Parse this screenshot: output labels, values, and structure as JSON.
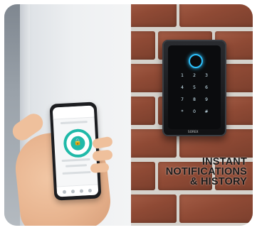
{
  "caption": {
    "line1": "INSTANT",
    "line2": "NOTIFICATIONS",
    "line3": "& HISTORY"
  },
  "device": {
    "logo": "SOREX",
    "keys": [
      "1",
      "2",
      "3",
      "4",
      "5",
      "6",
      "7",
      "8",
      "9",
      "*",
      "0",
      "#"
    ]
  },
  "colors": {
    "accent_teal": "#1fb9a8",
    "fingerprint_blue": "#2ec3ff",
    "brick": "#8f4a35"
  }
}
